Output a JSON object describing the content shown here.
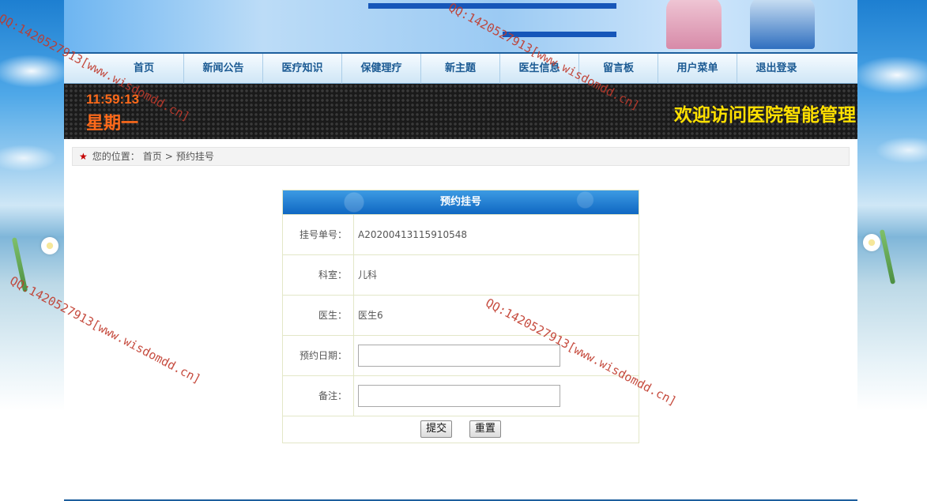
{
  "nav": {
    "items": [
      "首页",
      "新闻公告",
      "医疗知识",
      "保健理疗",
      "新主题",
      "医生信息",
      "留言板",
      "用户菜单",
      "退出登录"
    ]
  },
  "ticker": {
    "time": "11:59:13",
    "weekday": "星期一",
    "marquee": "欢迎访问医院智能管理"
  },
  "breadcrumb": {
    "prefix": "您的位置：",
    "home": "首页",
    "separator": ">",
    "current": "预约挂号"
  },
  "form": {
    "title": "预约挂号",
    "fields": [
      {
        "label": "挂号单号：",
        "value": "A20200413115910548"
      },
      {
        "label": "科室：",
        "value": "儿科"
      },
      {
        "label": "医生：",
        "value": "医生6"
      },
      {
        "label": "预约日期：",
        "value": ""
      },
      {
        "label": "备注：",
        "value": ""
      }
    ],
    "submit_label": "提交",
    "reset_label": "重置"
  },
  "watermark": {
    "text": "QQ:1420527913[www.wisdomdd.cn]"
  },
  "colors": {
    "accent": "#1d5f9d",
    "clock": "#ff6a1a",
    "marquee": "#ffe000",
    "header_blue": "#0f67c2"
  }
}
